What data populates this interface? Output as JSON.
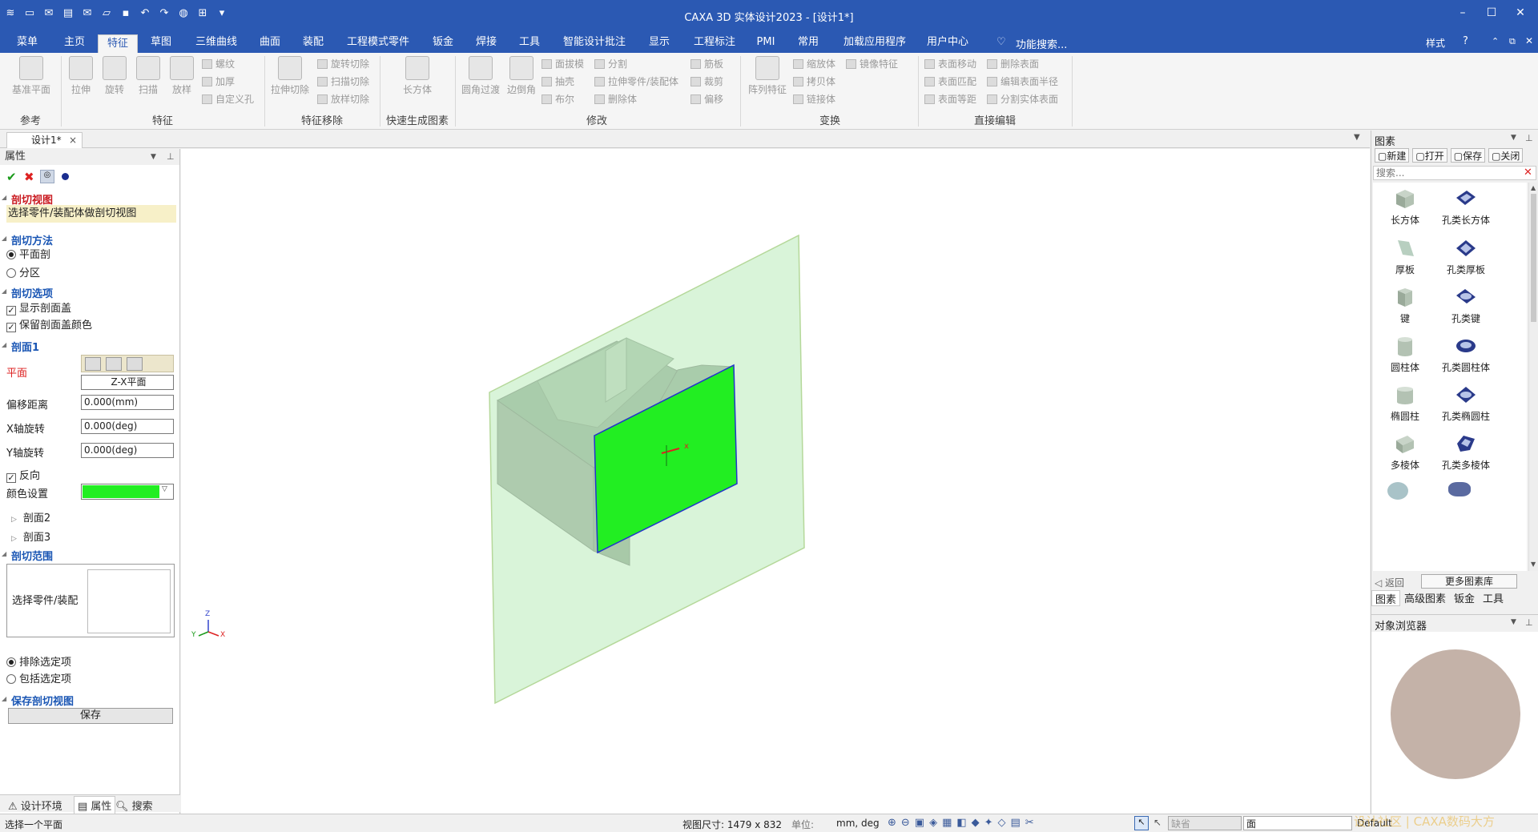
{
  "app": {
    "title": "CAXA 3D 实体设计2023 - [设计1*]"
  },
  "window_controls": {
    "minimize": "–",
    "maximize": "☐",
    "close": "✕"
  },
  "menu": {
    "tabs": [
      "菜单",
      "主页",
      "特征",
      "草图",
      "三维曲线",
      "曲面",
      "装配",
      "工程模式零件",
      "钣金",
      "焊接",
      "工具",
      "智能设计批注",
      "显示",
      "工程标注",
      "PMI",
      "常用",
      "加载应用程序",
      "用户中心"
    ],
    "active": "特征",
    "search_placeholder": "功能搜索...",
    "style_label": "样式"
  },
  "ribbon": {
    "ref_plane": "基准平面",
    "ref_group": "参考",
    "extrude": "拉伸",
    "revolve": "旋转",
    "sweep": "扫描",
    "loft": "放样",
    "thread": "螺纹",
    "thicken": "加厚",
    "custom_hole": "自定义孔",
    "feature_group": "特征",
    "extrude_cut": "拉伸切除",
    "revolve_cut": "旋转切除",
    "sweep_cut": "扫描切除",
    "loft_cut": "放样切除",
    "removal_group": "特征移除",
    "box": "长方体",
    "quick_group": "快速生成图素",
    "fillet": "圆角过渡",
    "chamfer": "边倒角",
    "draft": "面拔模",
    "shell": "抽壳",
    "boolean": "布尔",
    "split": "分割",
    "extrude_part": "拉伸零件/装配体",
    "delete_body": "删除体",
    "rib": "筋板",
    "trim": "裁剪",
    "offset": "偏移",
    "modify_group": "修改",
    "pattern": "阵列特征",
    "scale": "缩放体",
    "copy": "拷贝体",
    "link": "链接体",
    "mirror": "镜像特征",
    "transform_group": "变换",
    "move_face": "表面移动",
    "match_face": "表面匹配",
    "equidistant_face": "表面等距",
    "delete_face": "删除表面",
    "edit_radius": "编辑表面半径",
    "split_solid": "分割实体表面",
    "direct_group": "直接编辑"
  },
  "doc_tab": {
    "label": "设计1*",
    "close": "×"
  },
  "properties": {
    "title": "属性",
    "section_view": "剖切视图",
    "hint": "选择零件/装配体做剖切视图",
    "method": "剖切方法",
    "plane_cut": "平面剖",
    "zone": "分区",
    "options": "剖切选项",
    "show_cap": "显示剖面盖",
    "keep_cap_color": "保留剖面盖颜色",
    "section1": "剖面1",
    "plane_label": "平面",
    "plane_value": "Z-X平面",
    "offset_label": "偏移距离",
    "offset_value": "0.000(mm)",
    "xrot_label": "X轴旋转",
    "xrot_value": "0.000(deg)",
    "yrot_label": "Y轴旋转",
    "yrot_value": "0.000(deg)",
    "reverse": "反向",
    "color_label": "颜色设置",
    "cap_color": "#22ee22",
    "section2": "剖面2",
    "section3": "剖面3",
    "range": "剖切范围",
    "select_part": "选择零件/装配",
    "exclude": "排除选定项",
    "include": "包括选定项",
    "save_section": "保存剖切视图",
    "save_btn": "保存"
  },
  "left_tabs": {
    "env": "设计环境",
    "props": "属性",
    "search": "搜索"
  },
  "library": {
    "title": "图素",
    "new": "新建",
    "open": "打开",
    "save": "保存",
    "close": "关闭",
    "search_placeholder": "搜索...",
    "items": [
      "长方体",
      "孔类长方体",
      "厚板",
      "孔类厚板",
      "键",
      "孔类键",
      "圆柱体",
      "孔类圆柱体",
      "椭圆柱",
      "孔类椭圆柱",
      "多棱体",
      "孔类多棱体"
    ],
    "back": "返回",
    "more": "更多图素库",
    "tabs": [
      "图素",
      "高级图素",
      "钣金",
      "工具"
    ]
  },
  "browser": {
    "title": "对象浏览器"
  },
  "status": {
    "hint": "选择一个平面",
    "view_size": "视图尺寸: 1479 x 832",
    "unit_label": "单位:",
    "unit_value": "mm, deg",
    "default_combo": "缺省",
    "face_combo": "面",
    "scheme": "Default",
    "watermark": "设计社区 | CAXA数码大方"
  },
  "axis": {
    "x": "X",
    "y": "Y",
    "z": "Z"
  }
}
